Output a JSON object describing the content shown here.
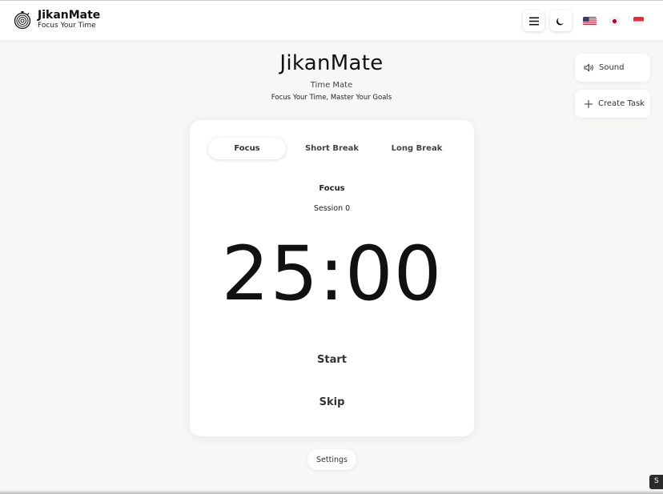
{
  "header": {
    "brand_title": "JikanMate",
    "brand_tagline": "Focus Your Time",
    "menu_icon": "hamburger-menu-icon",
    "theme_icon": "moon-icon",
    "languages": [
      "en",
      "ja",
      "id"
    ]
  },
  "hero": {
    "title": "JikanMate",
    "subtitle": "Time Mate",
    "motto": "Focus Your Time, Master Your Goals"
  },
  "side": {
    "sound_label": "Sound",
    "create_task_label": "Create Task"
  },
  "timer": {
    "tabs": [
      {
        "label": "Focus",
        "active": true
      },
      {
        "label": "Short Break",
        "active": false
      },
      {
        "label": "Long Break",
        "active": false
      }
    ],
    "mode_label": "Focus",
    "session_label": "Session 0",
    "time": "25:00",
    "start_label": "Start",
    "skip_label": "Skip"
  },
  "footer": {
    "settings_label": "Settings",
    "corner_badge": "S"
  },
  "colors": {
    "background": "#f7f7f5",
    "card": "#ffffff",
    "text": "#111111"
  }
}
